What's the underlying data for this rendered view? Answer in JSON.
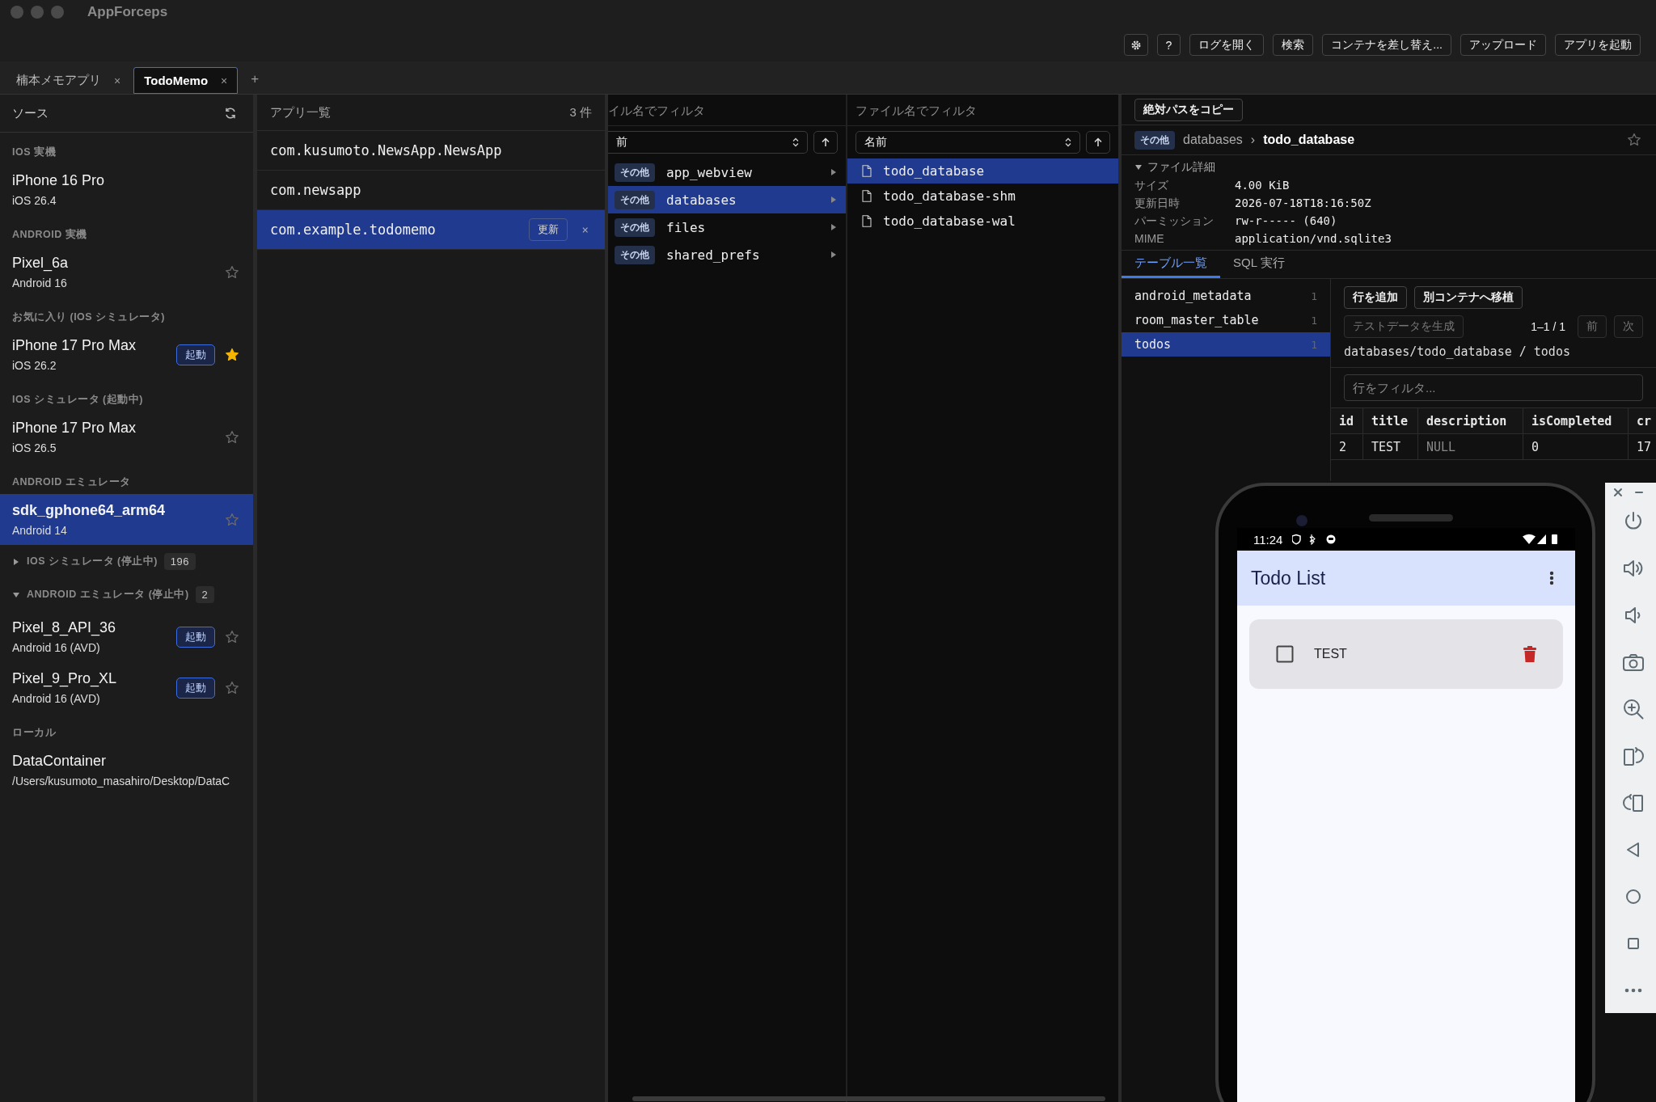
{
  "window": {
    "title": "AppForceps"
  },
  "toolbar": [
    {
      "kind": "settings"
    },
    {
      "kind": "text",
      "label": "?"
    },
    {
      "kind": "text",
      "label": "ログを開く"
    },
    {
      "kind": "text",
      "label": "検索"
    },
    {
      "kind": "text",
      "label": "コンテナを差し替え..."
    },
    {
      "kind": "text",
      "label": "アップロード"
    },
    {
      "kind": "text",
      "label": "アプリを起動"
    }
  ],
  "tabs": [
    {
      "label": "楠本メモアプリ",
      "close": "×",
      "selected": false
    },
    {
      "label": "TodoMemo",
      "close": "×",
      "selected": true
    }
  ],
  "new_tab": "+",
  "sidebar": {
    "title": "ソース",
    "groups": [
      {
        "heading": "IOS 実機",
        "items": [
          {
            "name": "iPhone 16 Pro",
            "detail": "iOS 26.4",
            "selected": false
          }
        ]
      },
      {
        "heading": "ANDROID 実機",
        "items": [
          {
            "name": "Pixel_6a",
            "detail": "Android 16",
            "selected": false,
            "starred": false
          }
        ]
      },
      {
        "heading": "お気に入り (IOS シミュレータ)",
        "items": [
          {
            "name": "iPhone 17 Pro Max",
            "detail": "iOS 26.2",
            "selected": false,
            "launch": "起動",
            "starred": true
          }
        ]
      },
      {
        "heading": "IOS シミュレータ (起動中)",
        "items": [
          {
            "name": "iPhone 17 Pro Max",
            "detail": "iOS 26.5",
            "selected": false,
            "starred": false
          }
        ]
      },
      {
        "heading": "ANDROID エミュレータ",
        "items": [
          {
            "name": "sdk_gphone64_arm64",
            "detail": "Android 14",
            "selected": true,
            "starred": false
          }
        ]
      },
      {
        "heading": "IOS シミュレータ (停止中)",
        "expanded": false,
        "count": "196"
      },
      {
        "heading": "ANDROID エミュレータ (停止中)",
        "expanded": true,
        "count": "2",
        "items": [
          {
            "name": "Pixel_8_API_36",
            "detail": "Android 16 (AVD)",
            "selected": false,
            "launch": "起動",
            "starred": false
          },
          {
            "name": "Pixel_9_Pro_XL",
            "detail": "Android 16 (AVD)",
            "selected": false,
            "launch": "起動",
            "starred": false
          }
        ]
      },
      {
        "heading": "ローカル",
        "items": [
          {
            "name": "DataContainer",
            "detail": "/Users/kusumoto_masahiro/Desktop/DataC",
            "selected": false
          }
        ]
      }
    ]
  },
  "apps": {
    "title": "アプリ一覧",
    "count": "3 件",
    "items": [
      {
        "name": "com.kusumoto.NewsApp.NewsApp",
        "selected": false
      },
      {
        "name": "com.newsapp",
        "selected": false
      },
      {
        "name": "com.example.todomemo",
        "selected": true,
        "refresh": "更新",
        "close": "×"
      }
    ]
  },
  "folders": {
    "filter": {
      "placeholder": "イル名でフィルタ"
    },
    "sort": "前",
    "items": [
      {
        "tag": "その他",
        "name": "app_webview",
        "selected": false
      },
      {
        "tag": "その他",
        "name": "databases",
        "selected": true
      },
      {
        "tag": "その他",
        "name": "files",
        "selected": false
      },
      {
        "tag": "その他",
        "name": "shared_prefs",
        "selected": false
      }
    ]
  },
  "files": {
    "filter": {
      "placeholder": "ファイル名でフィルタ"
    },
    "sort": "名前",
    "items": [
      {
        "name": "todo_database",
        "selected": true
      },
      {
        "name": "todo_database-shm",
        "selected": false
      },
      {
        "name": "todo_database-wal",
        "selected": false
      }
    ]
  },
  "detail": {
    "copy_button": "絶対パスをコピー",
    "breadcrumb": {
      "tag": "その他",
      "parent": "databases",
      "separator": "›",
      "current": "todo_database",
      "starred": false
    },
    "file_info": {
      "title": "ファイル詳細",
      "expanded": true,
      "rows": [
        {
          "label": "サイズ",
          "value": "4.00 KiB"
        },
        {
          "label": "更新日時",
          "value": "2026-07-18T18:16:50Z"
        },
        {
          "label": "パーミッション",
          "value": "rw-r----- (640)"
        },
        {
          "label": "MIME",
          "value": "application/vnd.sqlite3"
        }
      ]
    },
    "tabs": [
      {
        "label": "テーブル一覧",
        "selected": true
      },
      {
        "label": "SQL 実行",
        "selected": false
      }
    ],
    "tables": [
      {
        "name": "android_metadata",
        "count": "1",
        "selected": false
      },
      {
        "name": "room_master_table",
        "count": "1",
        "selected": false
      },
      {
        "name": "todos",
        "count": "1",
        "selected": true
      }
    ],
    "actions": [
      {
        "label": "行を追加",
        "disabled": false
      },
      {
        "label": "別コンテナへ移植",
        "disabled": false
      }
    ],
    "generate": {
      "label": "テストデータを生成",
      "disabled": true
    },
    "pager": {
      "range": "1–1 / 1",
      "prev": {
        "label": "前",
        "disabled": true
      },
      "next": {
        "label": "次",
        "disabled": true
      }
    },
    "path": "databases/todo_database / todos",
    "row_filter": {
      "placeholder": "行をフィルタ..."
    },
    "grid": {
      "columns": [
        "id",
        "title",
        "description",
        "isCompleted",
        "cr"
      ],
      "rows": [
        {
          "cells": [
            {
              "value": "2",
              "is_null": false
            },
            {
              "value": "TEST",
              "is_null": false
            },
            {
              "value": "NULL",
              "is_null": true
            },
            {
              "value": "0",
              "is_null": false
            },
            {
              "value": "17",
              "is_null": false
            }
          ]
        }
      ]
    }
  },
  "emulator": {
    "time": "11:24",
    "app_title": "Todo List",
    "todos": [
      {
        "title": "TEST",
        "checked": false
      }
    ]
  }
}
